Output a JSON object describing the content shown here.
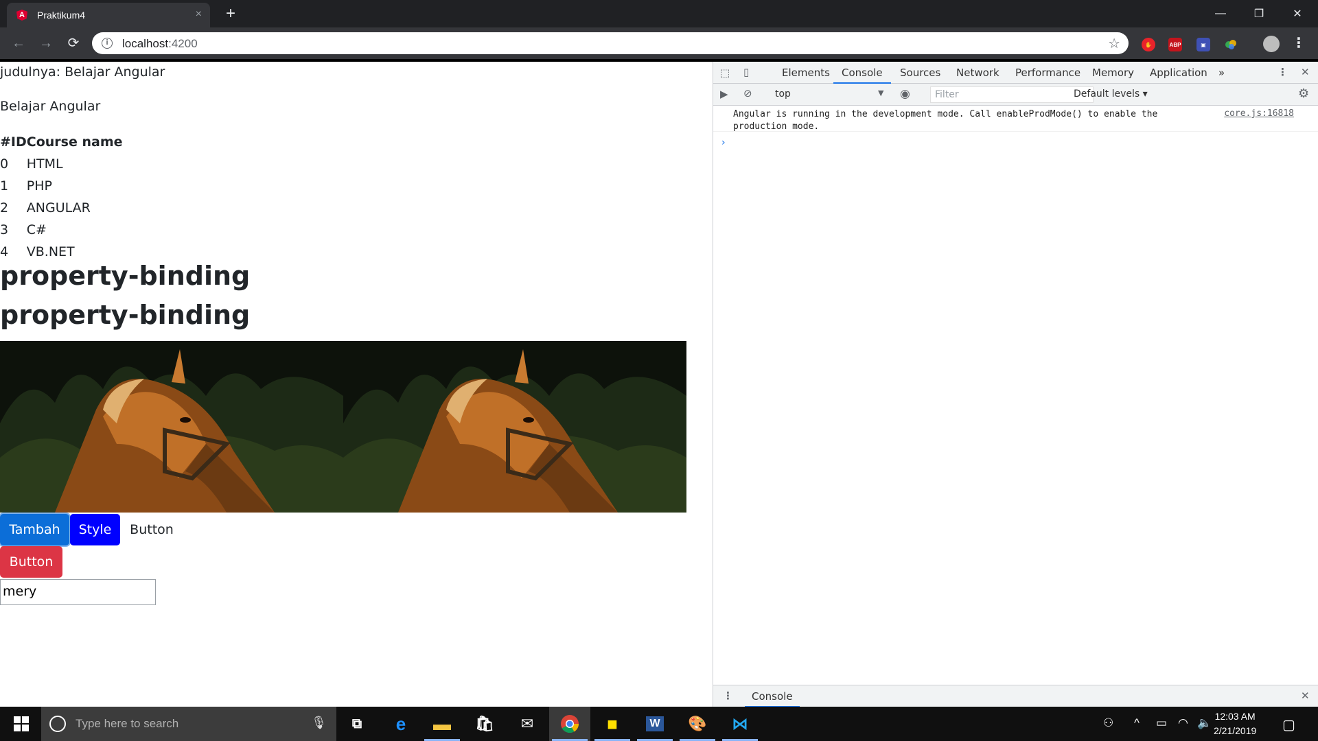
{
  "browser": {
    "tab_title": "Praktikum4",
    "tab_close": "×",
    "new_tab": "+",
    "url_host": "localhost",
    "url_port": ":4200",
    "window_controls": {
      "minimize": "—",
      "restore": "❐",
      "close": "✕"
    },
    "nav": {
      "back": "←",
      "forward": "→",
      "reload": "⟳"
    },
    "omni_info": "i",
    "bookmark_star": "☆",
    "extensions": [
      "ABP"
    ],
    "menu": "⋮"
  },
  "page": {
    "title_line": "judulnya: Belajar Angular",
    "subtitle": "Belajar Angular",
    "table": {
      "headers": [
        "#ID",
        "Course name"
      ],
      "rows": [
        [
          "0",
          "HTML"
        ],
        [
          "1",
          "PHP"
        ],
        [
          "2",
          "ANGULAR"
        ],
        [
          "3",
          "C#"
        ],
        [
          "4",
          "VB.NET"
        ]
      ]
    },
    "heading1": "property-binding",
    "heading2": "property-binding",
    "buttons": {
      "tambah": "Tambah",
      "style": "Style",
      "plain": "Button",
      "danger": "Button"
    },
    "input_value": "mery",
    "colors": {
      "primary": "#0c6ed8",
      "blue": "#0000ff",
      "danger": "#dc3545"
    }
  },
  "devtools": {
    "tabs": [
      "Elements",
      "Console",
      "Sources",
      "Network",
      "Performance",
      "Memory",
      "Application"
    ],
    "active_tab": "Console",
    "more": "»",
    "context": "top",
    "filter_placeholder": "Filter",
    "levels": "Default levels ▾",
    "message": "Angular is running in the development mode. Call enableProdMode() to enable the production mode.",
    "message_source": "core.js:16818",
    "prompt": "›",
    "drawer_tab": "Console",
    "close": "✕"
  },
  "taskbar": {
    "search_placeholder": "Type here to search",
    "time": "12:03 AM",
    "date": "2/21/2019"
  }
}
